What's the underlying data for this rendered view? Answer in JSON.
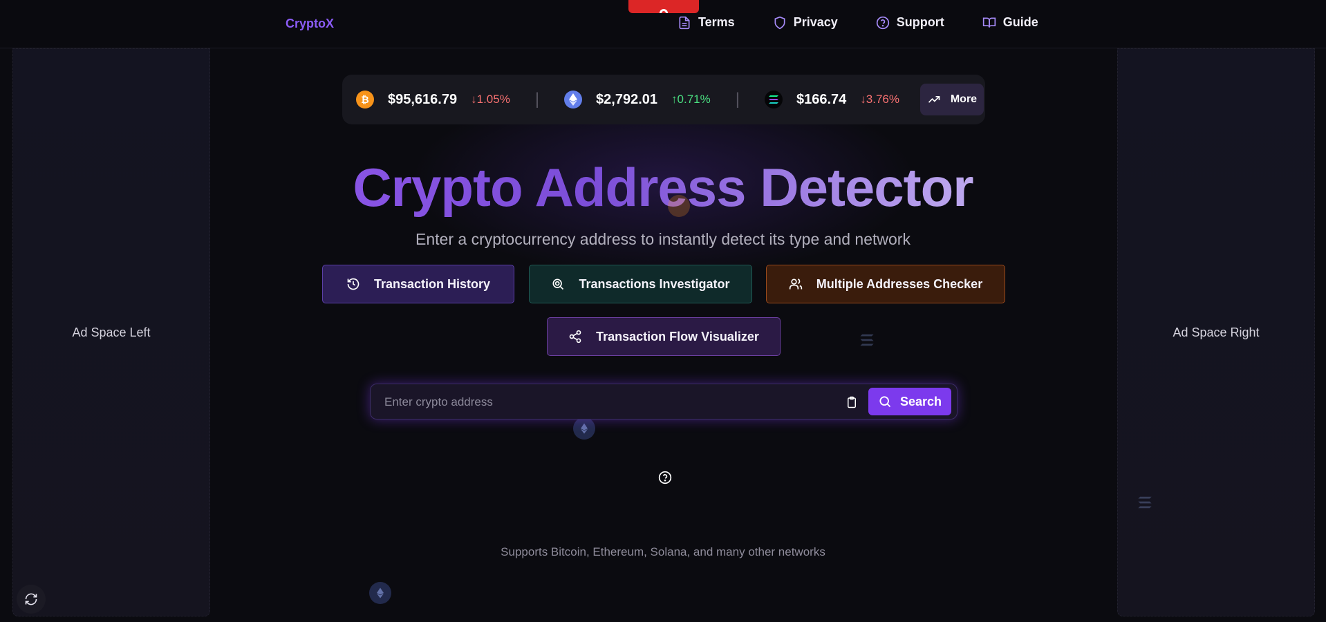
{
  "nav": {
    "brand": "CryptoX",
    "links": [
      {
        "label": "Terms",
        "icon": "document-icon"
      },
      {
        "label": "Privacy",
        "icon": "shield-icon"
      },
      {
        "label": "Support",
        "icon": "question-circle-icon"
      },
      {
        "label": "Guide",
        "icon": "book-open-icon"
      }
    ]
  },
  "ads": {
    "left": "Ad Space Left",
    "right": "Ad Space Right"
  },
  "ticker": {
    "coins": [
      {
        "icon": "bitcoin-icon",
        "price": "$95,616.79",
        "change": "↓1.05%",
        "direction": "down"
      },
      {
        "icon": "ethereum-icon",
        "price": "$2,792.01",
        "change": "↑0.71%",
        "direction": "up"
      },
      {
        "icon": "solana-icon",
        "price": "$166.74",
        "change": "↓3.76%",
        "direction": "down"
      }
    ],
    "more_label": "More"
  },
  "hero": {
    "title": "Crypto Address Detector",
    "subtitle": "Enter a cryptocurrency address to instantly detect its type and network"
  },
  "features": {
    "history": "Transaction History",
    "investigator": "Transactions Investigator",
    "multi": "Multiple Addresses Checker",
    "flow": "Transaction Flow Visualizer"
  },
  "search": {
    "placeholder": "Enter crypto address",
    "button_label": "Search"
  },
  "footer": {
    "supports": "Supports Bitcoin, Ethereum, Solana, and many other networks"
  },
  "colors": {
    "accent": "#7c3aed",
    "bitcoin": "#f7931a",
    "ethereum": "#627eea",
    "down": "#f87171",
    "up": "#4ade80"
  }
}
